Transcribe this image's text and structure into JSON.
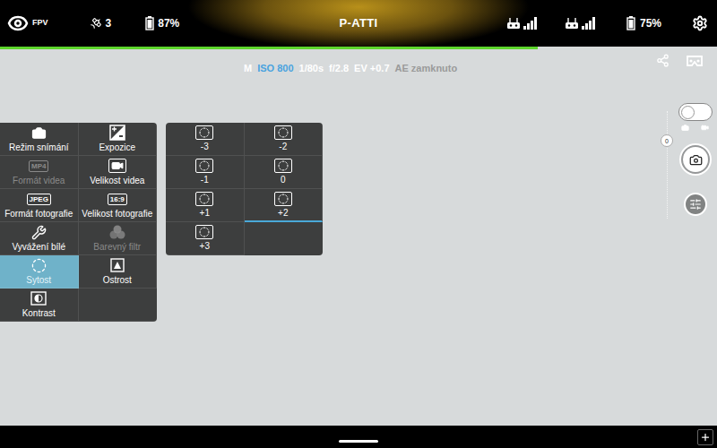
{
  "top_bar": {
    "view_mode": "FPV",
    "satellites": "3",
    "rc_battery": "87%",
    "flight_mode": "P-ATTI",
    "aircraft_battery": "75%"
  },
  "progress": {
    "level": 0.75
  },
  "camera_params": [
    {
      "text": "M",
      "color": "#ffffff"
    },
    {
      "text": "ISO 800",
      "color": "#4aa3df"
    },
    {
      "text": "1/80s",
      "color": "#ffffff"
    },
    {
      "text": "f/2.8",
      "color": "#ffffff"
    },
    {
      "text": "EV +0.7",
      "color": "#ffffff"
    },
    {
      "text": "AE zamknuto",
      "color": "#9a9a9a"
    }
  ],
  "settings_menu": [
    {
      "label": "Režim snímání",
      "badge": "",
      "selected": false,
      "disabled": false
    },
    {
      "label": "Expozice",
      "badge": "",
      "selected": false,
      "disabled": false
    },
    {
      "label": "Formát videa",
      "badge": "MP4",
      "selected": false,
      "disabled": true
    },
    {
      "label": "Velikost videa",
      "badge": "",
      "selected": false,
      "disabled": false
    },
    {
      "label": "Formát fotografie",
      "badge": "JPEG",
      "selected": false,
      "disabled": false
    },
    {
      "label": "Velikost fotografie",
      "badge": "16:9",
      "selected": false,
      "disabled": false
    },
    {
      "label": "Vyvážení bílé",
      "badge": "",
      "selected": false,
      "disabled": false
    },
    {
      "label": "Barevný filtr",
      "badge": "",
      "selected": false,
      "disabled": true
    },
    {
      "label": "Sytost",
      "badge": "",
      "selected": true,
      "disabled": false
    },
    {
      "label": "Ostrost",
      "badge": "",
      "selected": false,
      "disabled": false
    },
    {
      "label": "Kontrast",
      "badge": "",
      "selected": false,
      "disabled": false
    }
  ],
  "saturation_options": [
    {
      "label": "-3",
      "selected": false
    },
    {
      "label": "-2",
      "selected": false
    },
    {
      "label": "-1",
      "selected": false
    },
    {
      "label": "0",
      "selected": false
    },
    {
      "label": "+1",
      "selected": false
    },
    {
      "label": "+2",
      "selected": true
    },
    {
      "label": "+3",
      "selected": false
    }
  ],
  "capture_toggle": {
    "on": false
  },
  "ev_slider": {
    "reading": "0"
  }
}
